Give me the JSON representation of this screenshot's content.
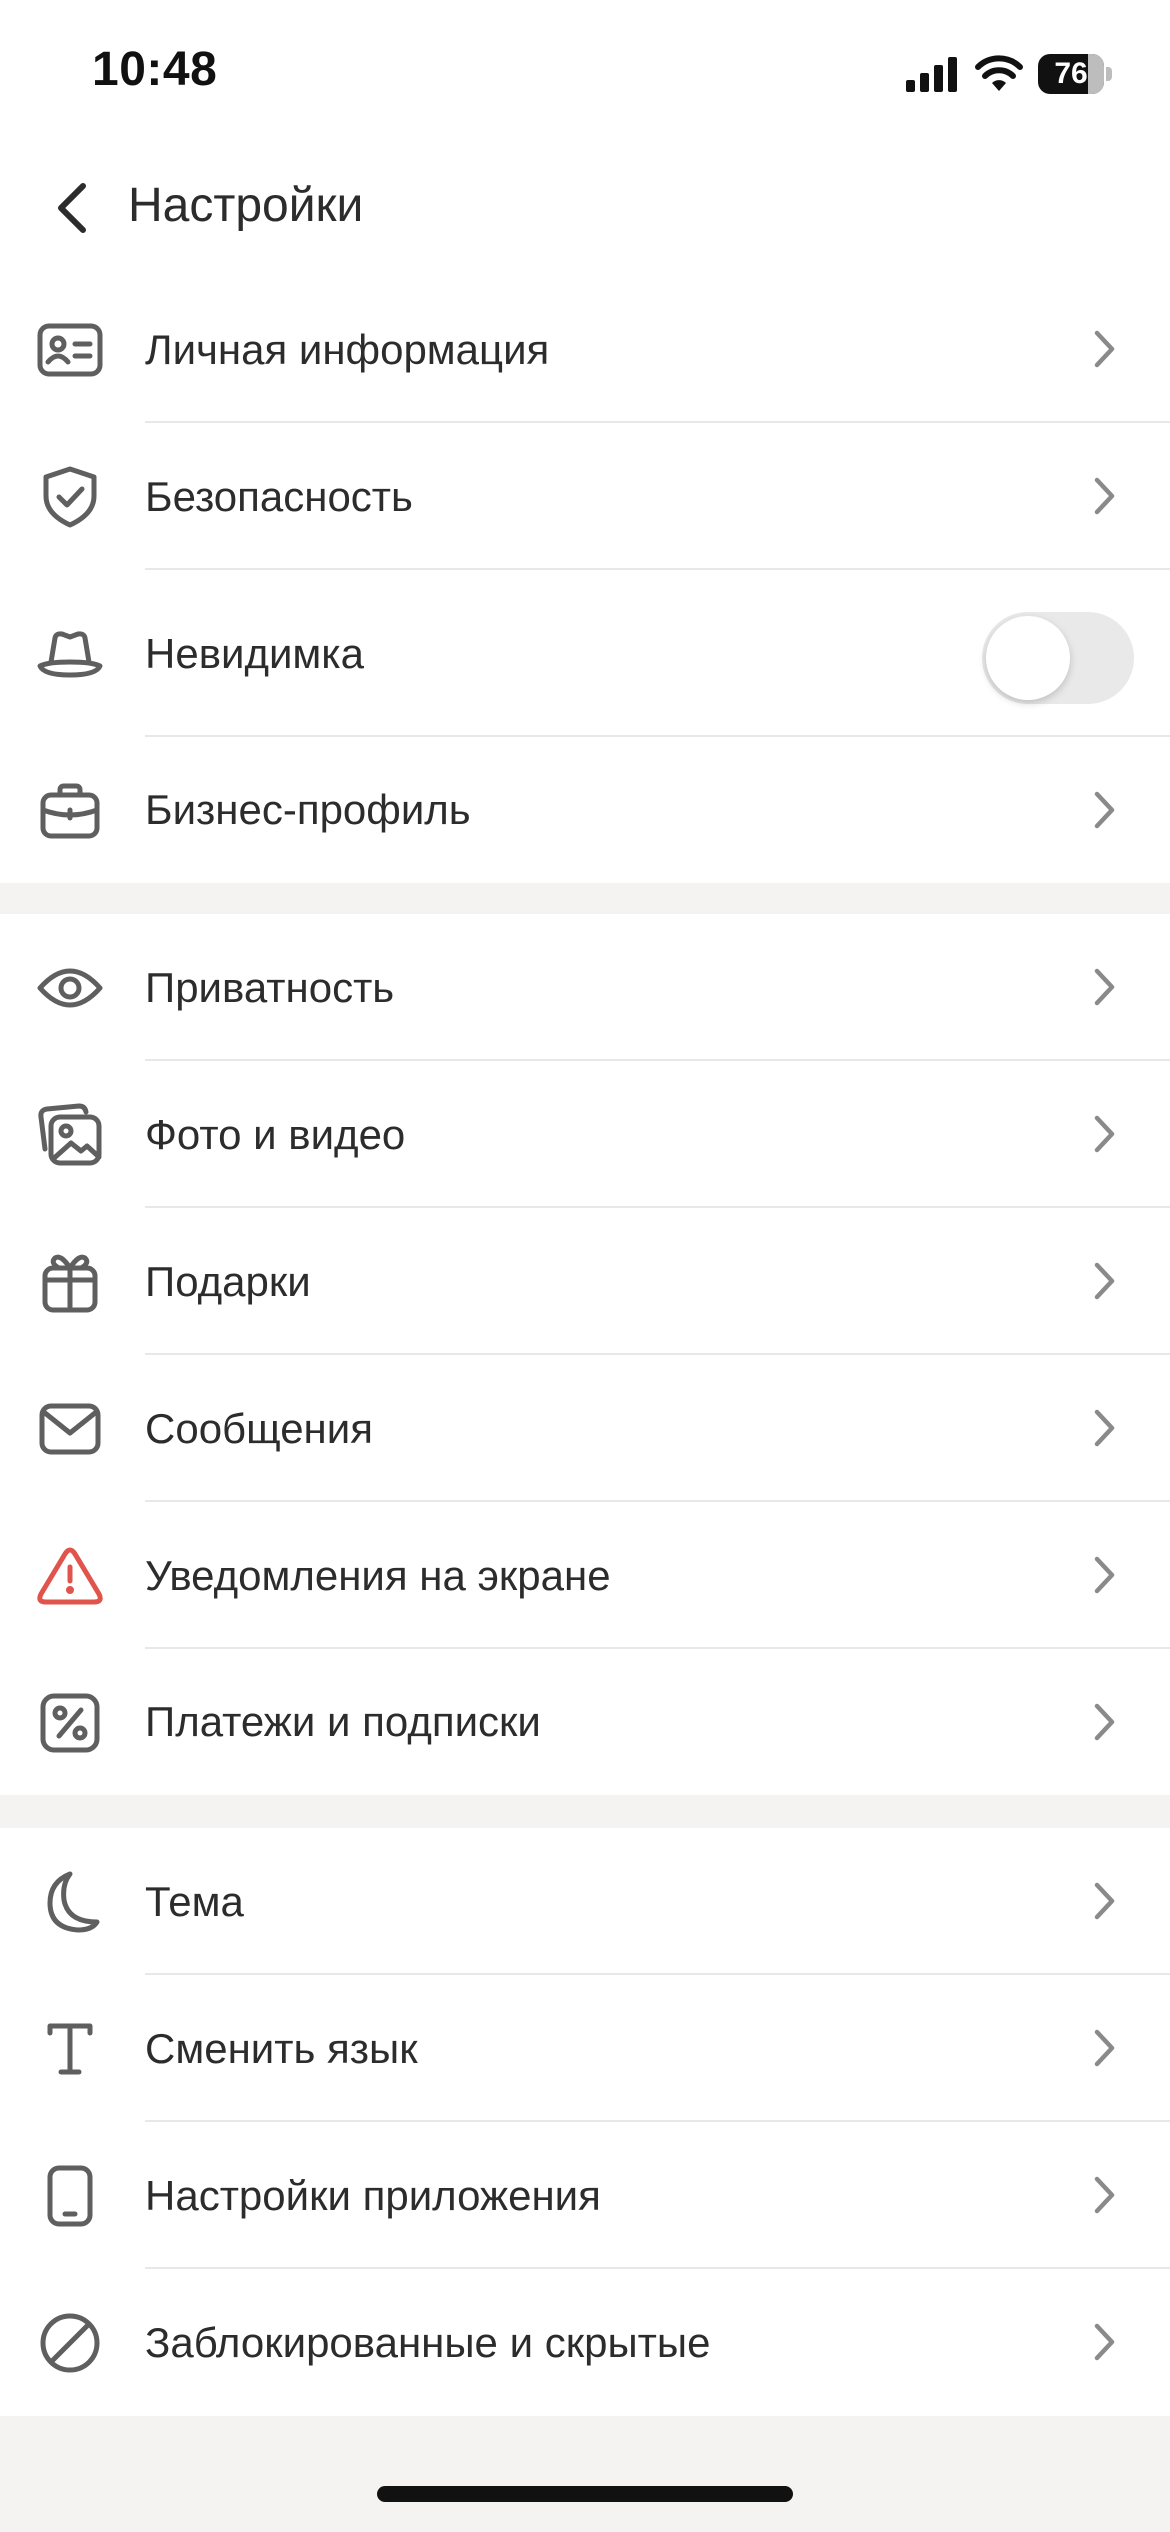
{
  "status_bar": {
    "time": "10:48",
    "battery_percent": "76",
    "signal_icon": "signal-bars-icon",
    "wifi_icon": "wifi-icon"
  },
  "nav": {
    "title": "Настройки",
    "back_icon": "chevron-left-icon"
  },
  "sections": [
    {
      "items": [
        {
          "label": "Личная информация",
          "icon": "id-card-icon",
          "accessory": "chevron"
        },
        {
          "label": "Безопасность",
          "icon": "shield-check-icon",
          "accessory": "chevron"
        },
        {
          "label": "Невидимка",
          "icon": "hat-icon",
          "accessory": "toggle",
          "toggle_on": false
        },
        {
          "label": "Бизнес-профиль",
          "icon": "briefcase-icon",
          "accessory": "chevron"
        }
      ]
    },
    {
      "items": [
        {
          "label": "Приватность",
          "icon": "eye-icon",
          "accessory": "chevron"
        },
        {
          "label": "Фото и видео",
          "icon": "photos-icon",
          "accessory": "chevron"
        },
        {
          "label": "Подарки",
          "icon": "gift-icon",
          "accessory": "chevron"
        },
        {
          "label": "Сообщения",
          "icon": "envelope-icon",
          "accessory": "chevron"
        },
        {
          "label": "Уведомления на экране",
          "icon": "warning-icon",
          "accessory": "chevron"
        },
        {
          "label": "Платежи и подписки",
          "icon": "percent-icon",
          "accessory": "chevron"
        }
      ]
    },
    {
      "items": [
        {
          "label": "Тема",
          "icon": "moon-icon",
          "accessory": "chevron"
        },
        {
          "label": "Сменить язык",
          "icon": "text-t-icon",
          "accessory": "chevron"
        },
        {
          "label": "Настройки приложения",
          "icon": "phone-icon",
          "accessory": "chevron"
        },
        {
          "label": "Заблокированные и скрытые",
          "icon": "block-icon",
          "accessory": "chevron"
        }
      ]
    }
  ],
  "colors": {
    "icon_gray": "#5f5f5f",
    "warning_red": "#e0544c",
    "chevron_gray": "#8a8a8a",
    "section_gap": "#f4f3f1"
  }
}
